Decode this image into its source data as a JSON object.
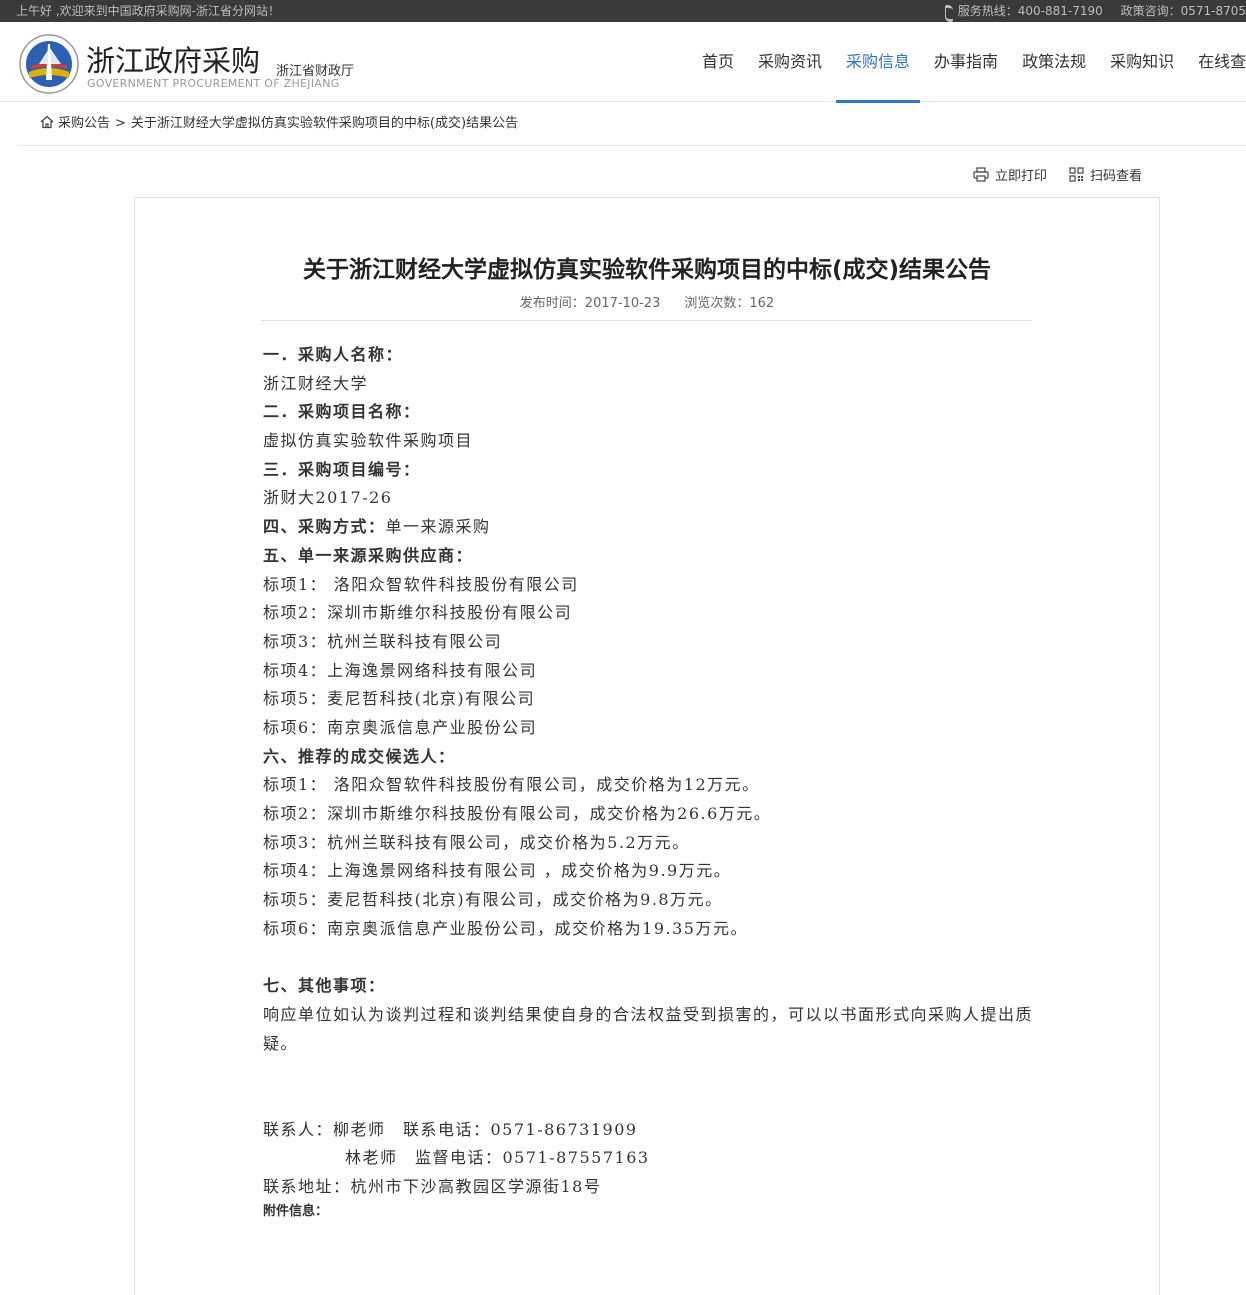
{
  "topbar": {
    "welcome": "上午好 ,欢迎来到中国政府采购网-浙江省分网站！",
    "hotline": "服务热线：400-881-7190",
    "policy": "政策咨询：0571-8705"
  },
  "header": {
    "title": "浙江政府采购",
    "subtitle": "浙江省财政厅",
    "english": "GOVERNMENT PROCUREMENT OF ZHEJIANG"
  },
  "nav": [
    {
      "label": "首页"
    },
    {
      "label": "采购资讯"
    },
    {
      "label": "采购信息"
    },
    {
      "label": "办事指南"
    },
    {
      "label": "政策法规"
    },
    {
      "label": "采购知识"
    },
    {
      "label": "在线查"
    }
  ],
  "colors": {
    "accent": "#2f77c5",
    "topbar": "#3a3a3a"
  },
  "breadcrumb": {
    "root": "采购公告",
    "sep": ">",
    "current": "关于浙江财经大学虚拟仿真实验软件采购项目的中标(成交)结果公告"
  },
  "tools": {
    "print": "立即打印",
    "scan": "扫码查看"
  },
  "article": {
    "title": "关于浙江财经大学虚拟仿真实验软件采购项目的中标(成交)结果公告",
    "publish": "发布时间：2017-10-23",
    "views": "浏览次数：162",
    "s1_heading": "一．采购人名称：",
    "s1_value": "浙江财经大学",
    "s2_heading": "二．采购项目名称：",
    "s2_value": "虚拟仿真实验软件采购项目",
    "s3_heading": "三．采购项目编号：",
    "s3_value": "浙财大2017-26",
    "s4_heading": "四、采购方式：",
    "s4_value": "单一来源采购",
    "s5_heading": "五、单一来源采购供应商：",
    "suppliers": [
      "标项1： 洛阳众智软件科技股份有限公司",
      "标项2：深圳市斯维尔科技股份有限公司",
      "标项3：杭州兰联科技有限公司",
      "标项4：上海逸景网络科技有限公司",
      "标项5：麦尼哲科技(北京)有限公司",
      "标项6：南京奥派信息产业股份公司"
    ],
    "s6_heading": "六、推荐的成交候选人：",
    "candidates": [
      "标项1： 洛阳众智软件科技股份有限公司，成交价格为12万元。",
      "标项2：深圳市斯维尔科技股份有限公司，成交价格为26.6万元。",
      "标项3：杭州兰联科技有限公司，成交价格为5.2万元。",
      "标项4：上海逸景网络科技有限公司 ，成交价格为9.9万元。",
      "标项5：麦尼哲科技(北京)有限公司，成交价格为9.8万元。",
      "标项6：南京奥派信息产业股份公司，成交价格为19.35万元。"
    ],
    "s7_heading": "七、其他事项：",
    "s7_text": "响应单位如认为谈判过程和谈判结果使自身的合法权益受到损害的，可以以书面形式向采购人提出质疑。",
    "contact1": "联系人：柳老师　联系电话：0571-86731909",
    "contact2": "林老师　监督电话：0571-87557163",
    "address": "联系地址：杭州市下沙高教园区学源街18号",
    "attachment": "附件信息："
  }
}
